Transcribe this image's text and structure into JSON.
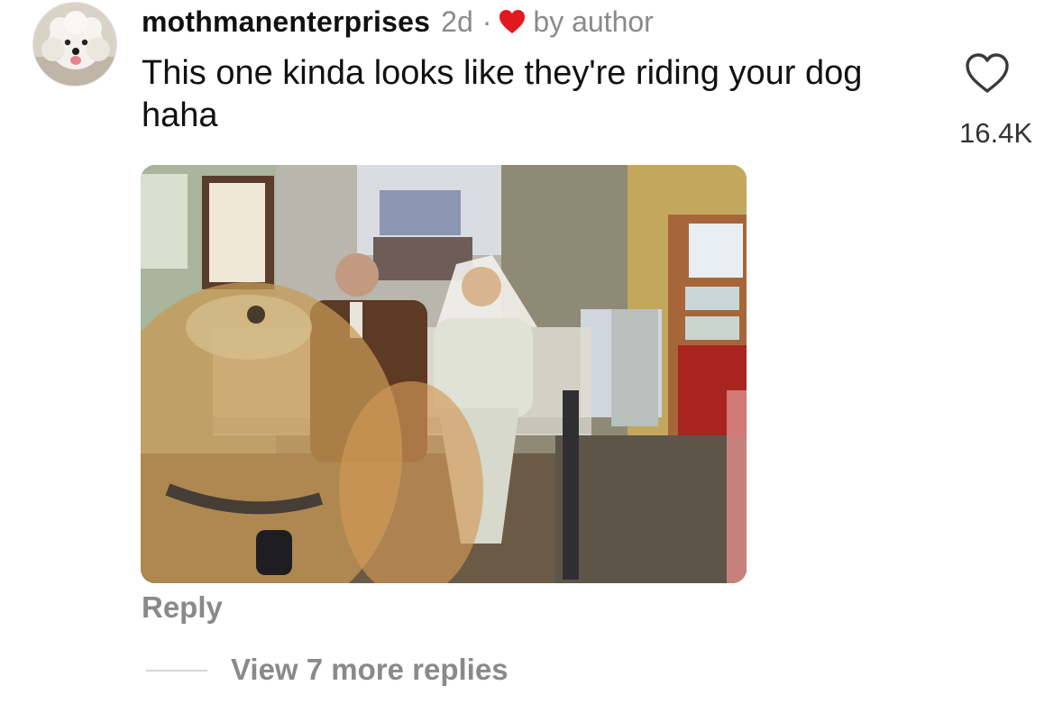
{
  "comment": {
    "username": "mothmanenterprises",
    "age": "2d",
    "separator": "·",
    "author_badge": "by author",
    "author_heart_color": "#e0191f",
    "text": "This one kinda looks like they're riding your dog haha",
    "like_count": "16.4K",
    "like_icon": "heart-outline-icon",
    "reply_label": "Reply",
    "view_more_label": "View 7 more replies",
    "avatar_icon": "poodle-avatar",
    "attachment": "photo-couple-on-bench-with-dog"
  }
}
